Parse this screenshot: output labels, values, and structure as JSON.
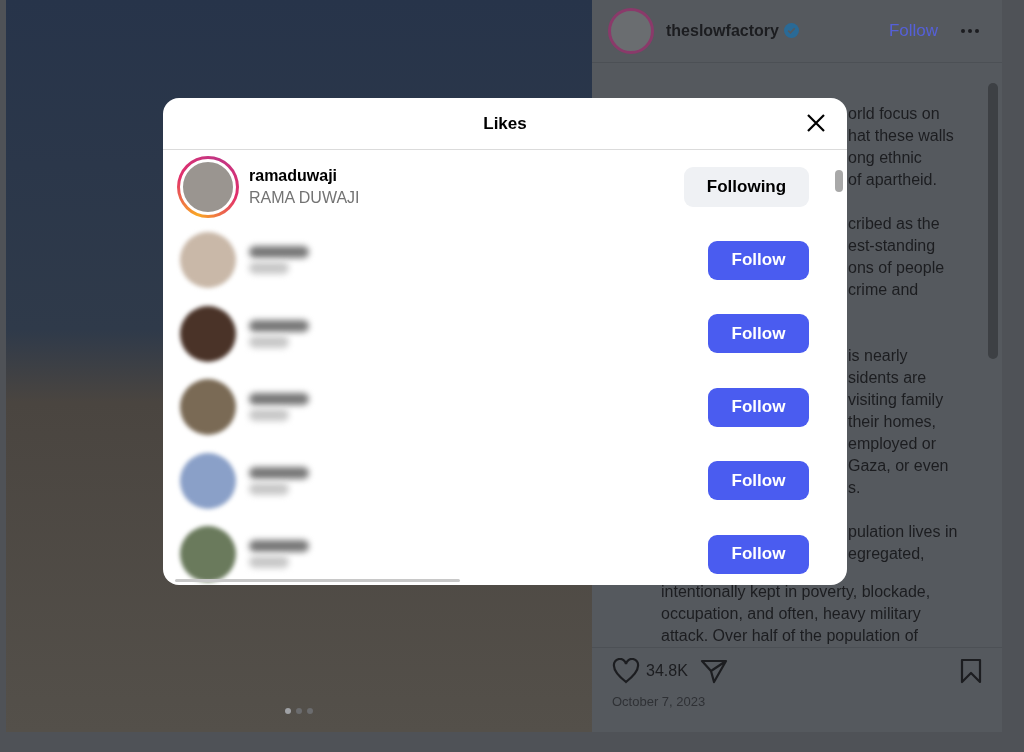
{
  "post": {
    "author": "theslowfactory",
    "verified": true,
    "follow": "Follow",
    "caption_paragraphs": [
      [
        "orld focus on",
        "hat these walls",
        "ong ethnic",
        "of apartheid."
      ],
      [
        "cribed as the",
        "est-standing",
        "ons of people",
        "crime and"
      ],
      [
        "is nearly",
        "sidents are",
        "visiting family",
        "their homes,",
        "employed or",
        "Gaza, or even",
        "s."
      ],
      [
        "pulation lives in",
        "egregated,"
      ]
    ],
    "caption_lines": [
      "intentionally kept in poverty, blockade,",
      "occupation, and often, heavy military",
      "attack. Over half of the population of"
    ],
    "likes": "34.8K",
    "date": "October 7, 2023",
    "slides": [
      {
        "selected": true
      },
      {
        "selected": false
      },
      {
        "selected": false
      }
    ]
  },
  "likes_dialog": {
    "title": "Likes",
    "users": [
      {
        "kind": "visible",
        "username": "ramaduwaji",
        "full_name": "RAMA DUWAJI",
        "story_ring": true,
        "following": true,
        "button": "Following"
      },
      {
        "kind": "blurred",
        "story_ring": false,
        "following": false,
        "button": "Follow"
      },
      {
        "kind": "blurred",
        "story_ring": false,
        "following": false,
        "button": "Follow"
      },
      {
        "kind": "blurred",
        "story_ring": false,
        "following": false,
        "button": "Follow"
      },
      {
        "kind": "blurred",
        "story_ring": false,
        "following": false,
        "button": "Follow"
      },
      {
        "kind": "blurred",
        "story_ring": false,
        "following": false,
        "button": "Follow"
      }
    ]
  }
}
